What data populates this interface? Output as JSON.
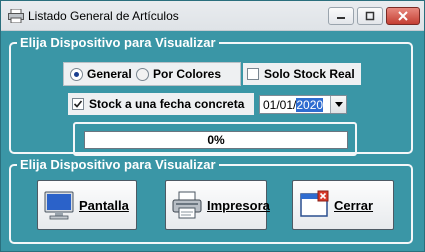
{
  "window": {
    "title": "Listado General de Artículos",
    "app_icon": "printer-icon"
  },
  "group1": {
    "title": "Elija Dispositivo para Visualizar",
    "radio_general": "General",
    "radio_por_colores": "Por Colores",
    "selected_radio": "General",
    "check_solo_stock": "Solo Stock Real",
    "check_solo_stock_checked": false,
    "check_stock_fecha": "Stock a una fecha concreta",
    "check_stock_fecha_checked": true,
    "date_prefix": "01/01/",
    "date_year": "2020",
    "progress_text": "0%",
    "progress_value": 0
  },
  "group2": {
    "title": "Elija Dispositivo para Visualizar",
    "btn_pantalla": "Pantalla",
    "btn_impresora": "Impresora",
    "btn_cerrar": "Cerrar",
    "icons": [
      "monitor-icon",
      "printer-icon",
      "close-window-icon"
    ]
  },
  "colors": {
    "window_bg": "#3a96a6",
    "selection": "#2f6cd0",
    "close_button": "#c43f33"
  }
}
